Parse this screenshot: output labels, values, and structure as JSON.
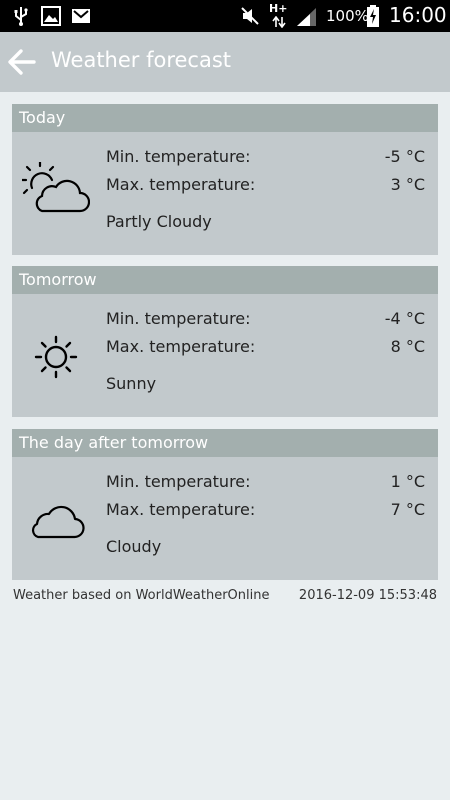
{
  "status_bar": {
    "battery": "100%",
    "time": "16:00",
    "network": "H+",
    "icons": [
      "usb-icon",
      "image-notification-icon",
      "gmail-icon",
      "mute-icon",
      "network-arrows-icon",
      "signal-icon",
      "battery-charging-icon"
    ]
  },
  "app_bar": {
    "title": "Weather forecast",
    "back_icon": "arrow-back-icon",
    "color": "#c2c9cc"
  },
  "labels": {
    "min": "Min. temperature:",
    "max": "Max. temperature:"
  },
  "forecast": [
    {
      "day": "Today",
      "icon": "partly-cloudy-icon",
      "min": "-5 °C",
      "max": "3 °C",
      "condition": "Partly Cloudy"
    },
    {
      "day": "Tomorrow",
      "icon": "sun-icon",
      "min": "-4 °C",
      "max": "8 °C",
      "condition": "Sunny"
    },
    {
      "day": "The day after tomorrow",
      "icon": "cloud-icon",
      "min": "1 °C",
      "max": "7 °C",
      "condition": "Cloudy"
    }
  ],
  "footer": {
    "source": "Weather based on WorldWeatherOnline",
    "timestamp": "2016-12-09 15:53:48"
  },
  "colors": {
    "background": "#e9eef0",
    "card": "#c2c9cc",
    "card_header": "#a3afae"
  }
}
